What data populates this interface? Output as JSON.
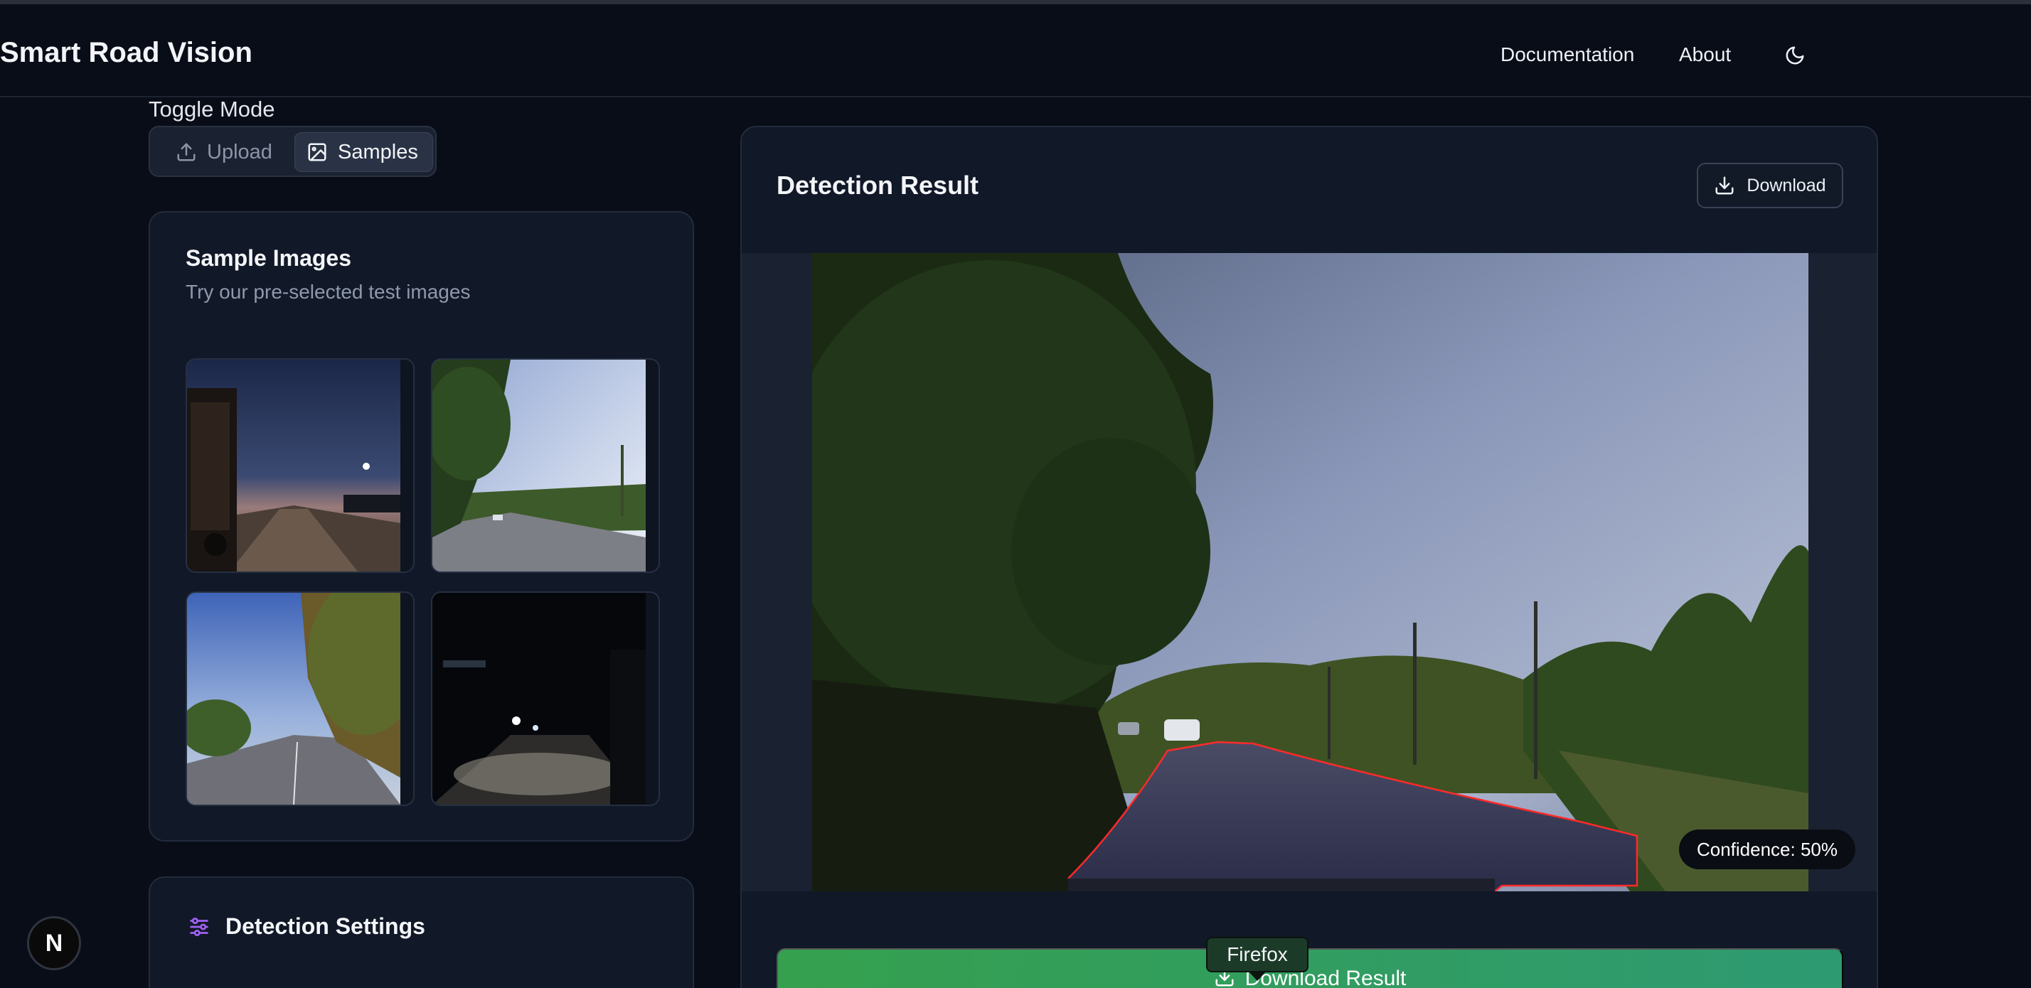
{
  "header": {
    "brand": "Smart Road Vision",
    "nav": [
      {
        "label": "Documentation"
      },
      {
        "label": "About"
      }
    ],
    "theme_icon": "moon-icon"
  },
  "mode": {
    "title": "Toggle Mode",
    "options": [
      {
        "label": "Upload",
        "icon": "upload-icon",
        "selected": false
      },
      {
        "label": "Samples",
        "icon": "image-icon",
        "selected": true
      }
    ]
  },
  "samples": {
    "title": "Sample Images",
    "subtitle": "Try our pre-selected test images",
    "items": [
      {
        "scene": "dusk-road-truck"
      },
      {
        "scene": "daylight-rural-road"
      },
      {
        "scene": "daylight-tree-lined-road"
      },
      {
        "scene": "night-road-headlights"
      }
    ]
  },
  "settings": {
    "title": "Detection Settings",
    "icon": "sliders-icon"
  },
  "result": {
    "title": "Detection Result",
    "download_label": "Download",
    "confidence_label": "Confidence: 50%",
    "download_result_label": "Download Result"
  },
  "tooltip": {
    "text": "Firefox"
  },
  "badge": {
    "text": "N"
  },
  "colors": {
    "background": "#090d17",
    "card": "#111827",
    "accent_green": "#35a04e",
    "detection_outline": "#ff2a2a"
  }
}
